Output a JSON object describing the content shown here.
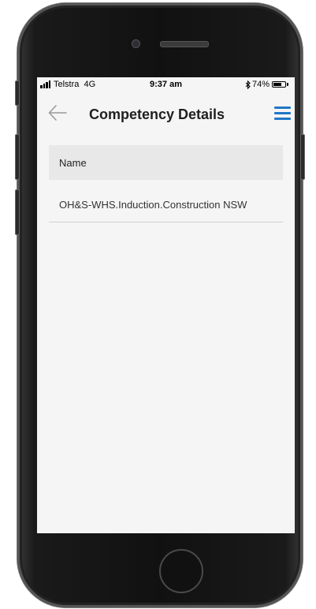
{
  "status_bar": {
    "carrier": "Telstra",
    "network": "4G",
    "time": "9:37 am",
    "battery_percent": "74%",
    "battery_level": 0.74,
    "bluetooth_icon": "bluetooth-icon"
  },
  "header": {
    "title": "Competency Details",
    "back_icon": "back-arrow-icon",
    "menu_icon": "hamburger-menu-icon",
    "accent_color": "#1f77c7"
  },
  "table": {
    "column_header": "Name",
    "rows": [
      {
        "name": "OH&S-WHS.Induction.Construction NSW"
      }
    ]
  }
}
